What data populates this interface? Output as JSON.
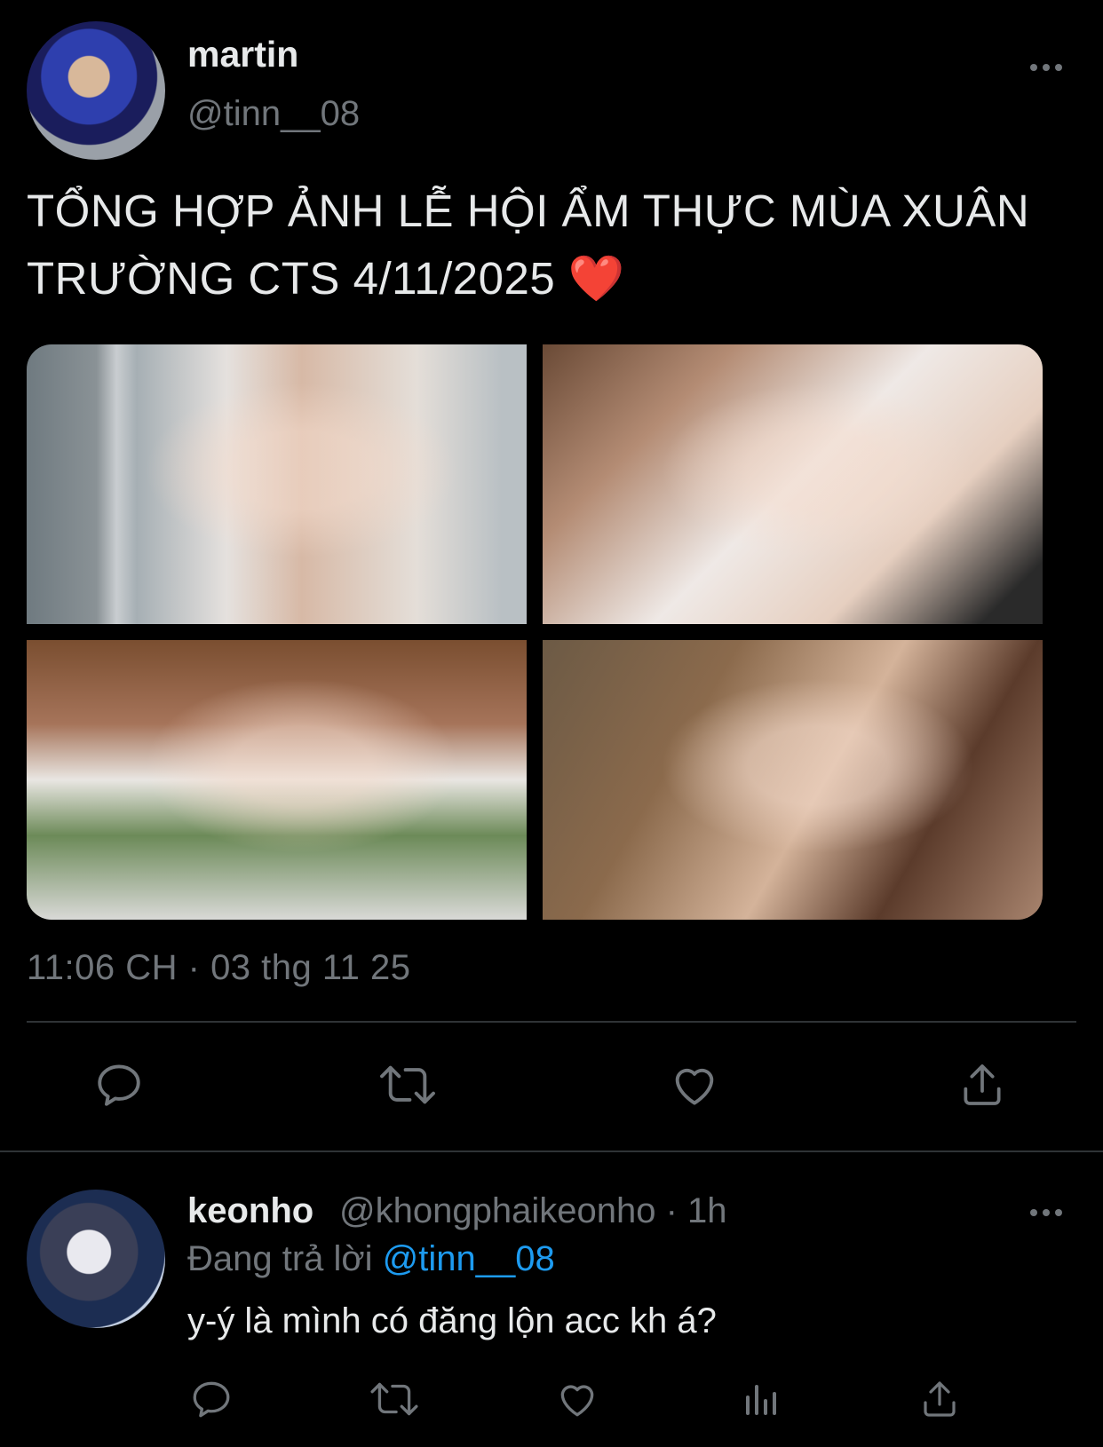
{
  "tweet": {
    "author": {
      "name": "martin",
      "handle": "@tinn__08"
    },
    "text_line1": "TỔNG HỢP ẢNH LỄ HỘI ẨM THỰC MÙA XUÂN",
    "text_line2": "TRƯỜNG CTS 4/11/2025",
    "text_emoji": "❤️",
    "photo_count": 4,
    "timestamp": "11:06 CH · 03 thg 11 25",
    "actions": [
      "reply-icon",
      "retweet-icon",
      "like-icon",
      "share-icon"
    ]
  },
  "reply": {
    "author": {
      "name": "keonho",
      "handle": "@khongphaikeonho",
      "time": "· 1h"
    },
    "context_prefix": "Đang trả lời",
    "context_mention": "@tinn__08",
    "text": "y-ý là mình có đăng lộn acc kh á?",
    "actions": [
      "reply-icon",
      "retweet-icon",
      "like-icon",
      "views-icon",
      "share-icon"
    ]
  },
  "colors": {
    "background": "#000000",
    "text_primary": "#e7e9ea",
    "text_secondary": "#71767b",
    "link": "#1d9bf0",
    "divider": "#2f3336"
  }
}
